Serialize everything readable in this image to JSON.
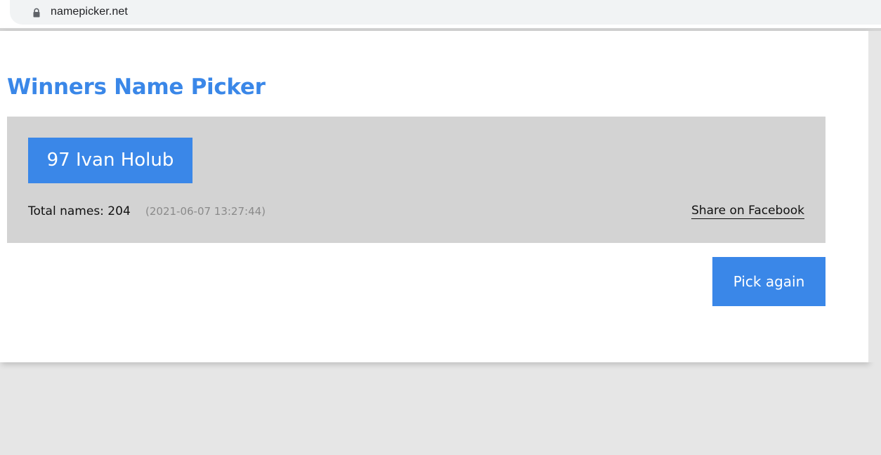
{
  "browser": {
    "url": "namepicker.net",
    "lock_icon": "lock-icon"
  },
  "page": {
    "title": "Winners Name Picker",
    "winner": "97 Ivan Holub",
    "total_names": "Total names: 204",
    "timestamp": "(2021-06-07 13:27:44)",
    "share_label": "Share on Facebook",
    "pick_again_label": "Pick again"
  },
  "colors": {
    "accent": "#3a87e8",
    "panel": "#d3d3d3",
    "background": "#e6e6e6"
  }
}
